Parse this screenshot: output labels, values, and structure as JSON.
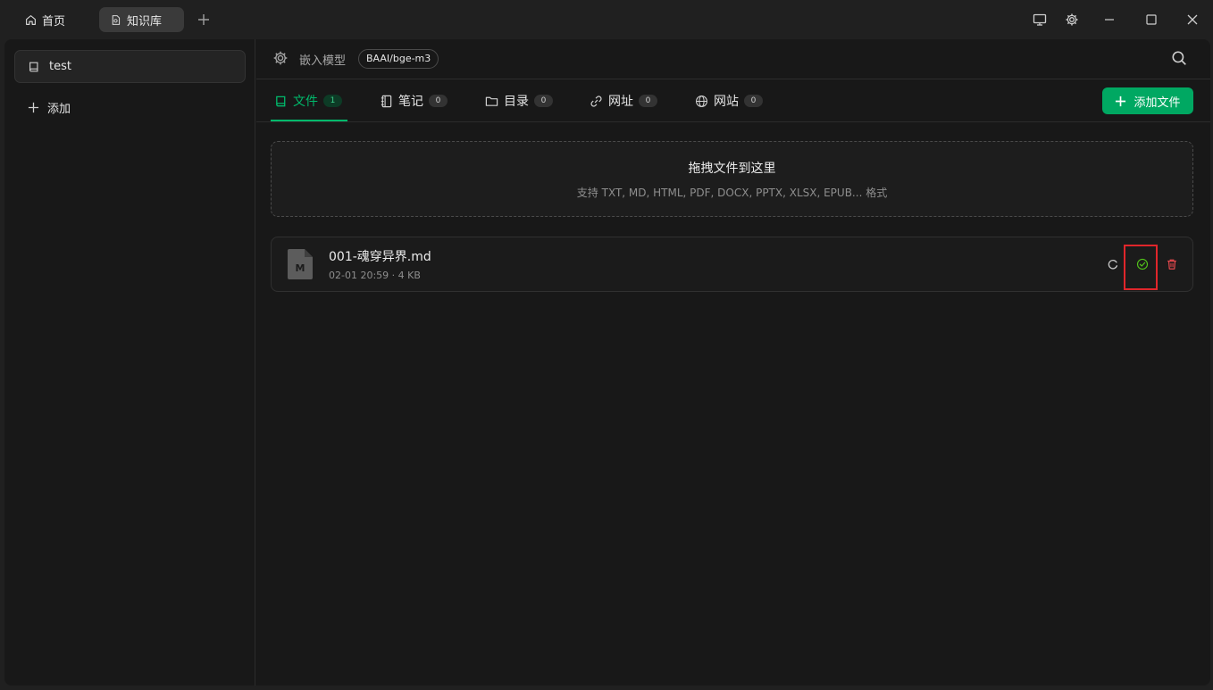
{
  "titlebar": {
    "tabs": [
      {
        "label": "首页",
        "icon": "home-icon"
      },
      {
        "label": "知识库",
        "icon": "knowledge-icon",
        "active": true
      }
    ]
  },
  "sidebar": {
    "items": [
      {
        "label": "test",
        "icon": "book-icon",
        "selected": true
      }
    ],
    "add_label": "添加"
  },
  "header": {
    "embed_label": "嵌入模型",
    "model": "BAAI/bge-m3"
  },
  "tabs": [
    {
      "label": "文件",
      "count": "1",
      "icon": "book-icon",
      "active": true
    },
    {
      "label": "笔记",
      "count": "0",
      "icon": "notebook-icon"
    },
    {
      "label": "目录",
      "count": "0",
      "icon": "folder-icon"
    },
    {
      "label": "网址",
      "count": "0",
      "icon": "link-icon"
    },
    {
      "label": "网站",
      "count": "0",
      "icon": "globe-icon"
    }
  ],
  "add_file_label": "添加文件",
  "dropzone": {
    "title": "拖拽文件到这里",
    "subtitle": "支持 TXT, MD, HTML, PDF, DOCX, PPTX, XLSX, EPUB... 格式"
  },
  "files": [
    {
      "name": "001-魂穿异界.md",
      "meta": "02-01 20:59 · 4 KB",
      "icon_letter": "M",
      "status": "processed"
    }
  ],
  "colors": {
    "accent": "#00b96b",
    "button": "#00a862",
    "success": "#52c41a",
    "danger": "#e5484d",
    "highlight": "#e0262b"
  }
}
